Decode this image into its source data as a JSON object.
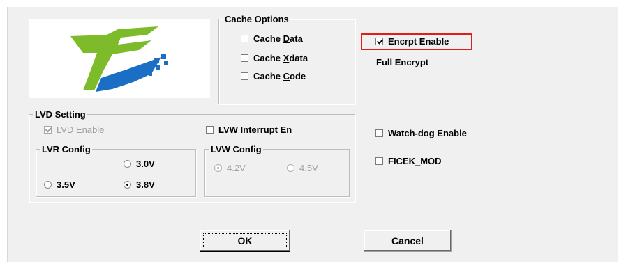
{
  "logo": {
    "name": "stc-logo",
    "colors": {
      "green": "#7dbb2a",
      "blue": "#1a6fc4"
    }
  },
  "cache_options": {
    "title": "Cache Options",
    "items": [
      {
        "pre": "Cache ",
        "mnemonic": "D",
        "post": "ata",
        "checked": false
      },
      {
        "pre": "Cache ",
        "mnemonic": "X",
        "post": "data",
        "checked": false
      },
      {
        "pre": "Cache ",
        "mnemonic": "C",
        "post": "ode",
        "checked": false
      }
    ]
  },
  "encrypt": {
    "label": "Encrpt Enable",
    "checked": true,
    "mode_text": "Full Encrypt",
    "highlight_color": "#e11c1c"
  },
  "lvd": {
    "title": "LVD Setting",
    "lvd_enable": {
      "label": "LVD Enable",
      "checked": true,
      "disabled": true
    },
    "lvw_interrupt": {
      "label": "LVW Interrupt En",
      "checked": false
    },
    "lvr_config": {
      "title": "LVR Config",
      "options": {
        "v30": "3.0V",
        "v35": "3.5V",
        "v38": "3.8V"
      },
      "selected": "3.8V"
    },
    "lvw_config": {
      "title": "LVW Config",
      "options": {
        "v42": "4.2V",
        "v45": "4.5V"
      },
      "selected": "4.2V",
      "disabled": true
    }
  },
  "watchdog": {
    "label": "Watch-dog Enable",
    "checked": false
  },
  "ficek": {
    "label": "FICEK_MOD",
    "checked": false
  },
  "buttons": {
    "ok": "OK",
    "cancel": "Cancel"
  }
}
